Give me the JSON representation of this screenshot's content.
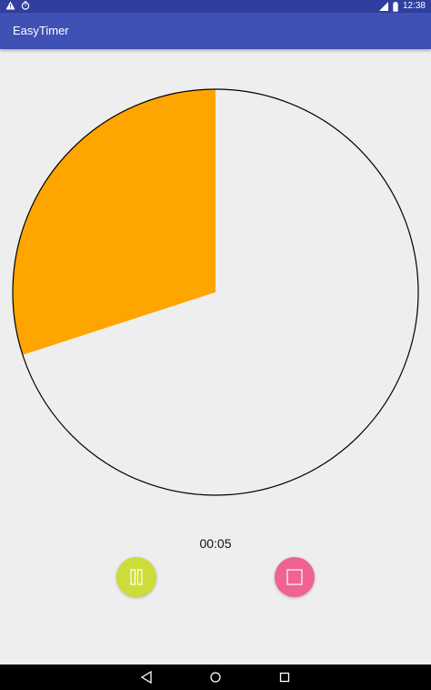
{
  "status_bar": {
    "time": "12:38",
    "icons": [
      "warning-icon",
      "alarm-icon",
      "signal-icon",
      "battery-icon"
    ]
  },
  "app_bar": {
    "title": "EasyTimer"
  },
  "timer": {
    "elapsed_text": "00:05",
    "progress_fraction": 0.3,
    "progress_color": "#ffa500",
    "ring_color": "#000000"
  },
  "controls": {
    "pause_color": "#cddc39",
    "stop_color": "#f06292",
    "icons": [
      "pause-icon",
      "stop-icon"
    ]
  },
  "navigation": {
    "icons": [
      "back-icon",
      "home-icon",
      "recents-icon"
    ]
  },
  "colors": {
    "primary": "#3f51b5",
    "primary_dark": "#303f9f",
    "background": "#eeeeee"
  }
}
